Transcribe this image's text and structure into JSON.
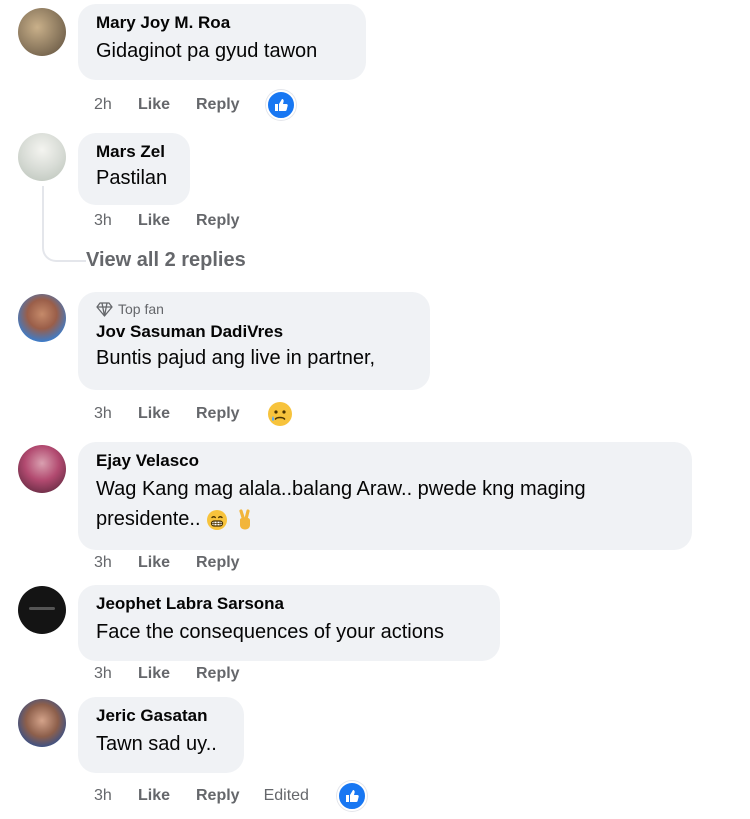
{
  "comments": [
    {
      "author": "Mary Joy M. Roa",
      "text": "Gidaginot pa gyud tawon",
      "time": "2h",
      "like_label": "Like",
      "reply_label": "Reply",
      "reaction": "like-reaction-icon"
    },
    {
      "author": "Mars Zel",
      "text": "Pastilan",
      "time": "3h",
      "like_label": "Like",
      "reply_label": "Reply"
    },
    {
      "badge": "Top fan",
      "author": "Jov Sasuman DadiVres",
      "text": "Buntis pajud ang live in partner,",
      "time": "3h",
      "like_label": "Like",
      "reply_label": "Reply",
      "reaction": "sad-reaction-icon"
    },
    {
      "author": "Ejay Velasco",
      "text": "Wag Kang mag alala..balang Araw.. pwede kng maging presidente..",
      "time": "3h",
      "like_label": "Like",
      "reply_label": "Reply"
    },
    {
      "author": "Jeophet Labra Sarsona",
      "text": "Face the consequences of your actions",
      "time": "3h",
      "like_label": "Like",
      "reply_label": "Reply"
    },
    {
      "author": "Jeric Gasatan",
      "text": "Tawn sad uy..",
      "time": "3h",
      "like_label": "Like",
      "reply_label": "Reply",
      "edited_label": "Edited",
      "reaction": "like-reaction-icon"
    }
  ],
  "view_replies": "View all 2 replies",
  "colors": {
    "bubble": "#f0f2f5",
    "meta_text": "#65676b",
    "like_blue": "#1877f2"
  }
}
